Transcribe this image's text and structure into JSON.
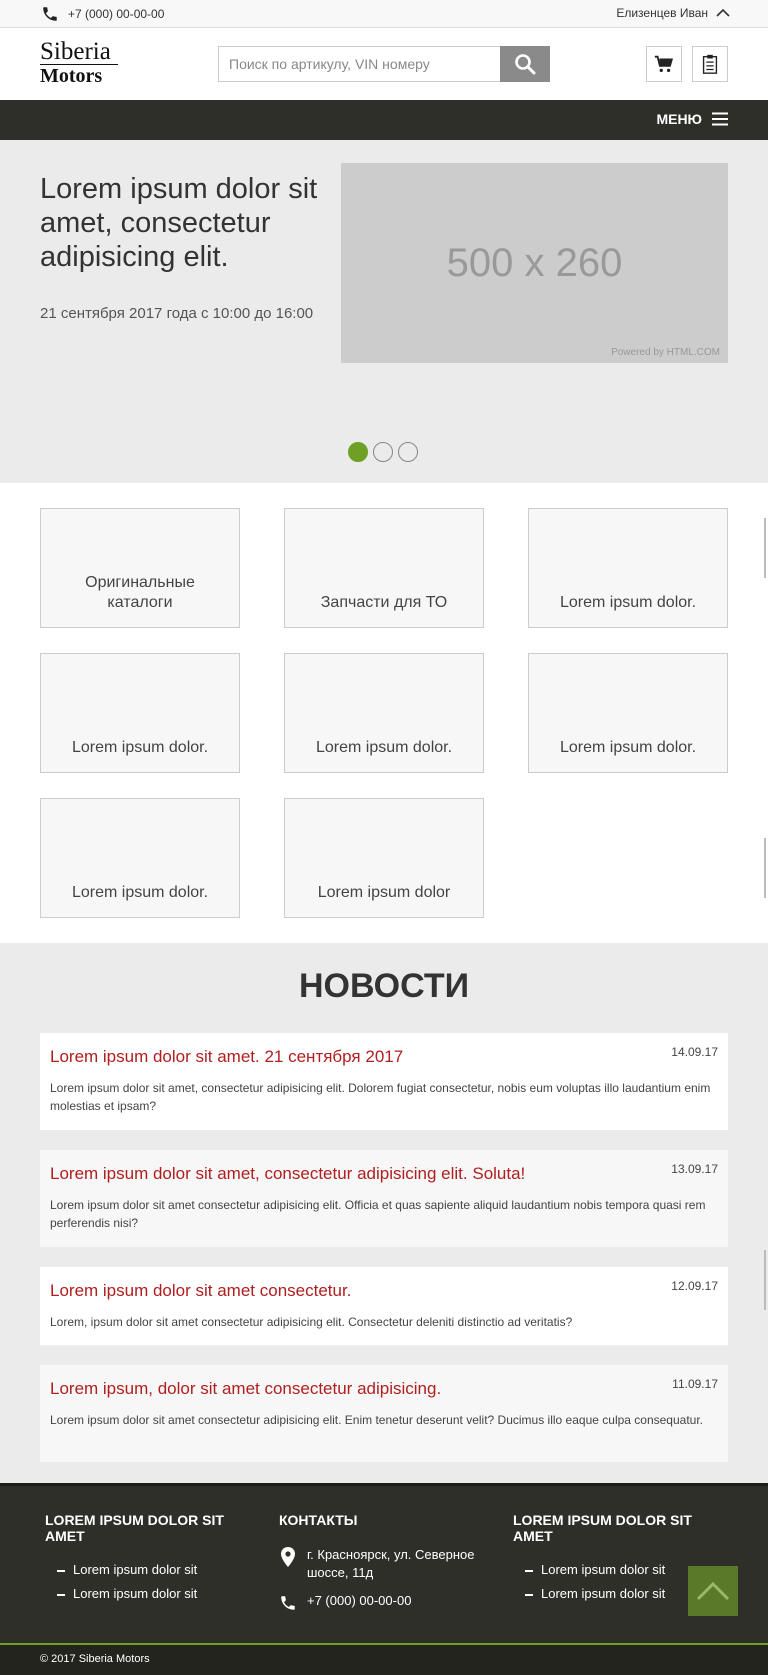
{
  "topbar": {
    "phone": "+7 (000) 00-00-00",
    "user": "Елизенцев Иван"
  },
  "header": {
    "logo_line1": "Siberia",
    "logo_line2": "Motors",
    "search_placeholder": "Поиск по артикулу, VIN номеру",
    "search_icon": "search-icon",
    "cart_icon": "cart-icon",
    "list_icon": "clipboard-icon"
  },
  "nav": {
    "menu_label": "МЕНЮ"
  },
  "hero": {
    "title": "Lorem ipsum dolor sit amet, consectetur adipisicing elit.",
    "date": "21 сентября 2017 года с 10:00 до 16:00",
    "placeholder_size": "500 x 260",
    "placeholder_credit": "Powered by HTML.COM",
    "slides": [
      true,
      false,
      false
    ]
  },
  "categories": [
    "Оригинальные каталоги",
    "Запчасти для ТО",
    "Lorem ipsum dolor.",
    "Lorem ipsum dolor.",
    "Lorem ipsum dolor.",
    "Lorem ipsum dolor.",
    "Lorem ipsum dolor.",
    "Lorem ipsum dolor"
  ],
  "news": {
    "heading": "НОВОСТИ",
    "items": [
      {
        "title": "Lorem ipsum dolor sit amet. 21 сентября 2017",
        "date": "14.09.17",
        "text": "Lorem ipsum dolor sit amet, consectetur adipisicing elit. Dolorem fugiat consectetur, nobis eum voluptas illo laudantium enim molestias et ipsam?"
      },
      {
        "title": "Lorem ipsum dolor sit amet, consectetur adipisicing elit. Soluta!",
        "date": "13.09.17",
        "text": "Lorem ipsum dolor sit amet consectetur adipisicing elit. Officia et quas sapiente aliquid laudantium nobis tempora quasi rem perferendis nisi?"
      },
      {
        "title": "Lorem ipsum dolor sit amet consectetur.",
        "date": "12.09.17",
        "text": "Lorem, ipsum dolor sit amet consectetur adipisicing elit. Consectetur deleniti distinctio ad veritatis?"
      },
      {
        "title": "Lorem ipsum, dolor sit amet consectetur adipisicing.",
        "date": "11.09.17",
        "text": "Lorem ipsum dolor sit amet consectetur adipisicing elit. Enim tenetur deserunt velit? Ducimus illo eaque culpa consequatur."
      }
    ]
  },
  "footer": {
    "col1": {
      "heading": "LOREM IPSUM DOLOR SIT AMET",
      "links": [
        "Lorem ipsum dolor sit",
        "Lorem ipsum dolor sit"
      ]
    },
    "col2": {
      "heading": "КОНТАКТЫ",
      "address": "г. Красноярск, ул. Северное шоссе, 11д",
      "phone": "+7 (000) 00-00-00"
    },
    "col3": {
      "heading": "LOREM IPSUM DOLOR SIT AMET",
      "links": [
        "Lorem ipsum dolor sit",
        "Lorem ipsum dolor sit"
      ]
    },
    "copyright": "© 2017 Siberia Motors"
  },
  "colors": {
    "accent_green": "#6fa026",
    "dark_bar": "#2f2f2a",
    "news_title_red": "#b01e1e"
  }
}
